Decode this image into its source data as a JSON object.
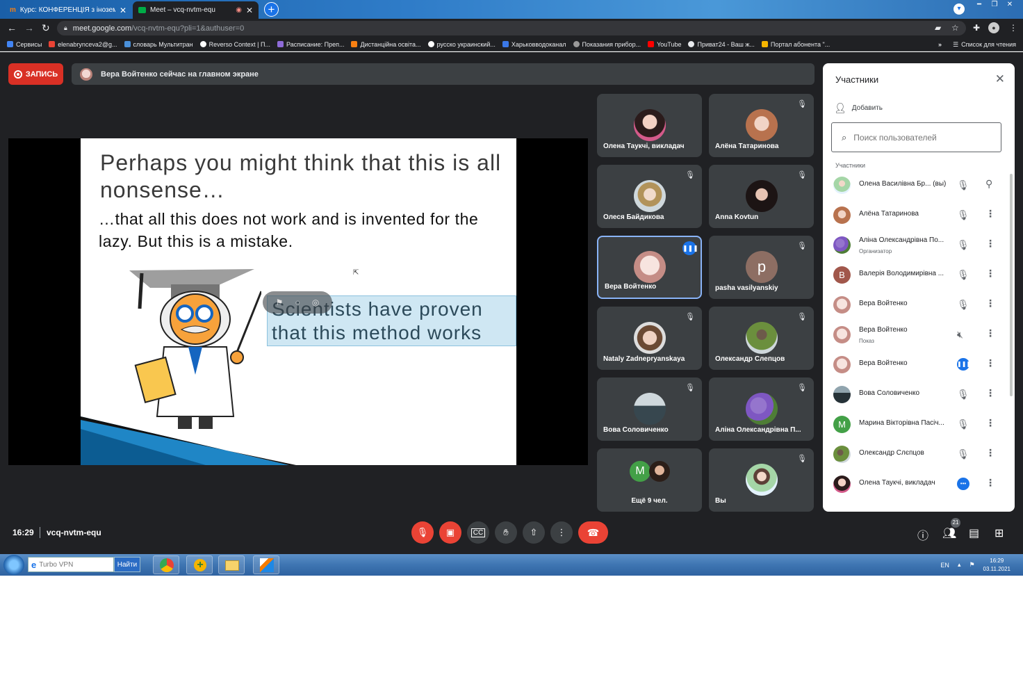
{
  "browser": {
    "tabs": [
      {
        "title": "Курс: КОНФЕРЕНЦІЯ з іноземно",
        "active": false
      },
      {
        "title": "Meet – vcq-nvtm-equ",
        "active": true
      }
    ],
    "url_host": "meet.google.com",
    "url_path": "/vcq-nvtm-equ?pli=1&authuser=0",
    "bookmarks": [
      "Сервисы",
      "elenabrynceva2@g...",
      "словарь Мультитран",
      "Reverso Context | П...",
      "Расписание: Преп...",
      "Дистанційна освіта...",
      "русско украинский...",
      "Харьковводоканал",
      "Показания прибор...",
      "YouTube",
      "Приват24 - Ваш ж...",
      "Портал абонента \"..."
    ],
    "bookmarks_more": "»",
    "reading_list": "Список для чтения"
  },
  "meet": {
    "record_label": "ЗАПИСЬ",
    "banner_text": "Вера Войтенко сейчас на главном экране",
    "slide": {
      "title": "Perhaps you might think that this is all nonsense…",
      "subtitle": "…that all this does not work and is invented for the lazy. But this is a mistake.",
      "callout": "Scientists have proven that this method works"
    },
    "tiles": [
      {
        "name": "Олена Таукчі, викладач",
        "muted": false
      },
      {
        "name": "Алёна Татаринова",
        "muted": true
      },
      {
        "name": "Олеся Байдикова",
        "muted": true
      },
      {
        "name": "Anna Kovtun",
        "muted": true
      },
      {
        "name": "Вера Войтенко",
        "muted": false
      },
      {
        "name": "pasha vasilyanskiy",
        "muted": true,
        "letter": "p"
      },
      {
        "name": "Nataly Zadnepryanskaya",
        "muted": true
      },
      {
        "name": "Олександр Слепцов",
        "muted": true
      },
      {
        "name": "Вова Соловиченко",
        "muted": true
      },
      {
        "name": "Аліна Олександрівна П...",
        "muted": true
      },
      {
        "name": "Ещё 9 чел.",
        "muted": false,
        "letter": "M"
      },
      {
        "name": "Вы",
        "muted": true
      }
    ],
    "meeting_time": "16:29",
    "meeting_code": "vcq-nvtm-equ",
    "participants_count": "21"
  },
  "panel": {
    "title": "Участники",
    "add_label": "Добавить",
    "search_placeholder": "Поиск пользователей",
    "section_label": "Участники",
    "participants": [
      {
        "name": "Олена Василівна Бр... (вы)",
        "sub": "",
        "mic": "muted",
        "action": "pin"
      },
      {
        "name": "Алёна Татаринова",
        "sub": "",
        "mic": "muted",
        "action": "more"
      },
      {
        "name": "Аліна Олександрівна По...",
        "sub": "Организатор",
        "mic": "muted",
        "action": "more"
      },
      {
        "name": "Валерія Володимирівна ...",
        "sub": "",
        "mic": "muted",
        "action": "more",
        "letter": "В"
      },
      {
        "name": "Вера Войтенко",
        "sub": "",
        "mic": "muted",
        "action": "more"
      },
      {
        "name": "Вера Войтенко",
        "sub": "Показ",
        "mic": "muted-screen",
        "action": "more"
      },
      {
        "name": "Вера Войтенко",
        "sub": "",
        "mic": "active",
        "action": "more"
      },
      {
        "name": "Вова Соловиченко",
        "sub": "",
        "mic": "muted",
        "action": "more"
      },
      {
        "name": "Марина Вікторівна Пасіч...",
        "sub": "",
        "mic": "muted",
        "action": "more",
        "letter": "M"
      },
      {
        "name": "Олександр Слєпцов",
        "sub": "",
        "mic": "muted",
        "action": "more"
      },
      {
        "name": "Олена Таукчі, викладач",
        "sub": "",
        "mic": "dots",
        "action": "more"
      }
    ]
  },
  "taskbar": {
    "search_text": "Turbo VPN",
    "find_label": "Найти",
    "lang": "EN",
    "clock_time": "16:29",
    "clock_date": "03.11.2021"
  },
  "colors": {
    "meet_bg": "#202124",
    "tile_bg": "#3c4043",
    "accent_blue": "#1a73e8",
    "danger_red": "#ea4335"
  }
}
